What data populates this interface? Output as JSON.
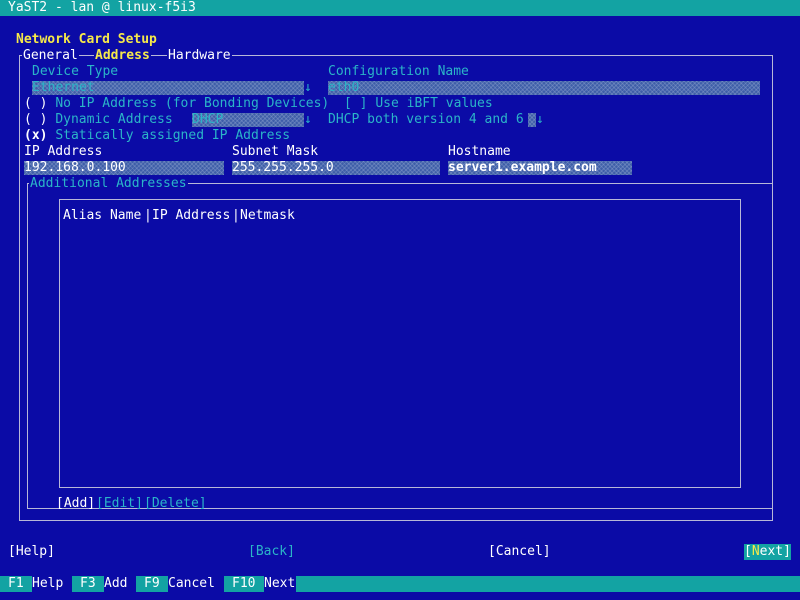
{
  "window": {
    "title": "YaST2 - lan @ linux-f5i3"
  },
  "dialog": {
    "title": "Network Card Setup"
  },
  "tabs": [
    "General",
    "Address",
    "Hardware"
  ],
  "device_type": {
    "label": "Device Type",
    "value": "Ethernet",
    "arrow": "↓"
  },
  "config_name": {
    "label": "Configuration Name",
    "value": "eth0"
  },
  "mode_no_ip": {
    "mark": "( )",
    "label": "No IP Address (for Bonding Devices)"
  },
  "ibft": {
    "mark": "[ ]",
    "label": "Use iBFT values"
  },
  "mode_dynamic": {
    "mark": "( )",
    "label": "Dynamic Address",
    "dhcp_value": "DHCP",
    "arrow": "↓"
  },
  "dhcp_version": {
    "value": "DHCP both version 4 and 6",
    "arrow": "↓"
  },
  "mode_static": {
    "mark": "(x)",
    "label": "Statically assigned IP Address"
  },
  "ip_address": {
    "label": "IP Address",
    "value": "192.168.0.100"
  },
  "subnet_mask": {
    "label": "Subnet Mask",
    "value": "255.255.255.0"
  },
  "hostname": {
    "label": "Hostname",
    "value": "server1.example.com"
  },
  "additional": {
    "title": "Additional Addresses",
    "columns": [
      "Alias Name",
      "IP Address",
      "Netmask"
    ],
    "add_label": "[Add]",
    "edit_label": "[Edit]",
    "delete_label": "[Delete]"
  },
  "buttons": {
    "help": "[Help]",
    "back": "[Back]",
    "cancel": "[Cancel]",
    "next_open": "[",
    "next_hot": "N",
    "next_rest": "ext]"
  },
  "function_keys": [
    {
      "key": "F1",
      "label": "Help"
    },
    {
      "key": "F3",
      "label": "Add"
    },
    {
      "key": "F9",
      "label": "Cancel"
    },
    {
      "key": "F10",
      "label": "Next"
    }
  ],
  "colors": {
    "background": "#0b0ba6",
    "title_bar": "#13a3a3",
    "highlight": "#f6e94a",
    "label": "#2bb5c8",
    "field": "#3e5ea8"
  }
}
